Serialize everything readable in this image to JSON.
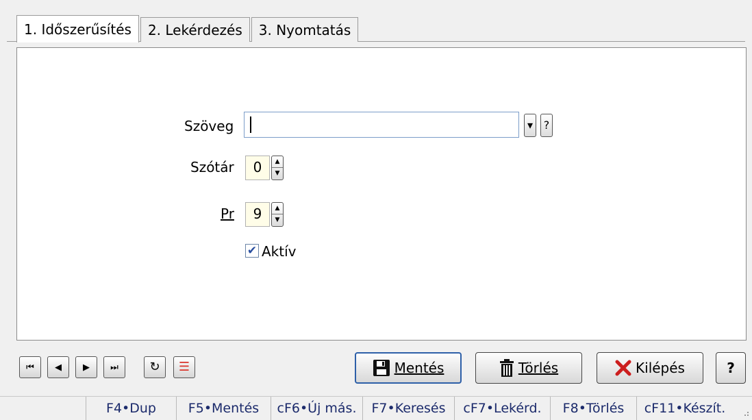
{
  "tabs": [
    {
      "label": "1. Időszerűsítés",
      "active": true
    },
    {
      "label": "2. Lekérdezés",
      "active": false
    },
    {
      "label": "3. Nyomtatás",
      "active": false
    }
  ],
  "form": {
    "szoveg_label": "Szöveg",
    "szoveg_value": "",
    "dropdown_glyph": "▾",
    "help_glyph": "?",
    "szotar_label": "Szótár",
    "szotar_value": "0",
    "pr_label": "Pr",
    "pr_value": "9",
    "aktiv_label": "Aktív",
    "aktiv_checked": true,
    "check_glyph": "✔"
  },
  "nav": {
    "first": "⏮",
    "prev": "◀",
    "next": "▶",
    "last": "⏭",
    "refresh": "↻",
    "list": "☰"
  },
  "actions": {
    "save_label": "Mentés",
    "delete_label": "Törlés",
    "exit_label": "Kilépés",
    "help_label": "?"
  },
  "statusbar": [
    "F4•Dup",
    "F5•Mentés",
    "cF6•Új más.",
    "F7•Keresés",
    "cF7•Lekérd.",
    "F8•Törlés",
    "cF11•Készít."
  ],
  "colors": {
    "accent_blue": "#2d5fa8",
    "exit_red": "#cc1e1e",
    "list_icon_red": "#d9342b",
    "number_field_bg": "#fffde8"
  }
}
